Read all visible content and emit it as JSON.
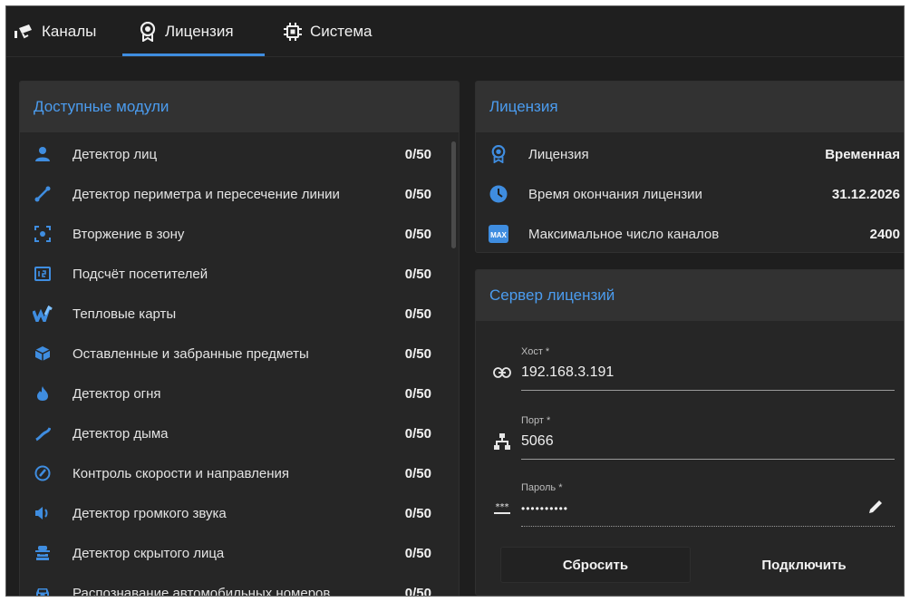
{
  "tabs": {
    "channels": "Каналы",
    "license": "Лицензия",
    "system": "Система"
  },
  "modules": {
    "title": "Доступные модули",
    "items": [
      {
        "label": "Детектор лиц",
        "count": "0/50",
        "icon": "person-icon"
      },
      {
        "label": "Детектор периметра и пересечение линии",
        "count": "0/50",
        "icon": "line-crossing-icon"
      },
      {
        "label": "Вторжение в зону",
        "count": "0/50",
        "icon": "zone-intrusion-icon"
      },
      {
        "label": "Подсчёт посетителей",
        "count": "0/50",
        "icon": "counter-icon"
      },
      {
        "label": "Тепловые карты",
        "count": "0/50",
        "icon": "heatmap-icon"
      },
      {
        "label": "Оставленные и забранные предметы",
        "count": "0/50",
        "icon": "box-icon"
      },
      {
        "label": "Детектор огня",
        "count": "0/50",
        "icon": "fire-icon"
      },
      {
        "label": "Детектор дыма",
        "count": "0/50",
        "icon": "smoke-icon"
      },
      {
        "label": "Контроль скорости и направления",
        "count": "0/50",
        "icon": "speedometer-icon"
      },
      {
        "label": "Детектор громкого звука",
        "count": "0/50",
        "icon": "speaker-icon"
      },
      {
        "label": "Детектор скрытого лица",
        "count": "0/50",
        "icon": "masked-face-icon"
      },
      {
        "label": "Распознавание автомобильных номеров",
        "count": "0/50",
        "icon": "car-icon"
      }
    ]
  },
  "license": {
    "title": "Лицензия",
    "rows": [
      {
        "label": "Лицензия",
        "value": "Временная",
        "icon": "license-badge-icon"
      },
      {
        "label": "Время окончания лицензии",
        "value": "31.12.2026",
        "icon": "clock-icon"
      },
      {
        "label": "Максимальное число каналов",
        "value": "2400",
        "icon": "max-icon"
      }
    ],
    "max_badge": "MAX"
  },
  "server": {
    "title": "Сервер лицензий",
    "host_label": "Хост *",
    "host_value": "192.168.3.191",
    "port_label": "Порт *",
    "port_value": "5066",
    "password_label": "Пароль *",
    "password_value": "••••••••••",
    "reset_label": "Сбросить",
    "connect_label": "Подключить"
  },
  "colors": {
    "accent": "#3f8de0",
    "background": "#1e1e1e",
    "card": "#262626"
  }
}
